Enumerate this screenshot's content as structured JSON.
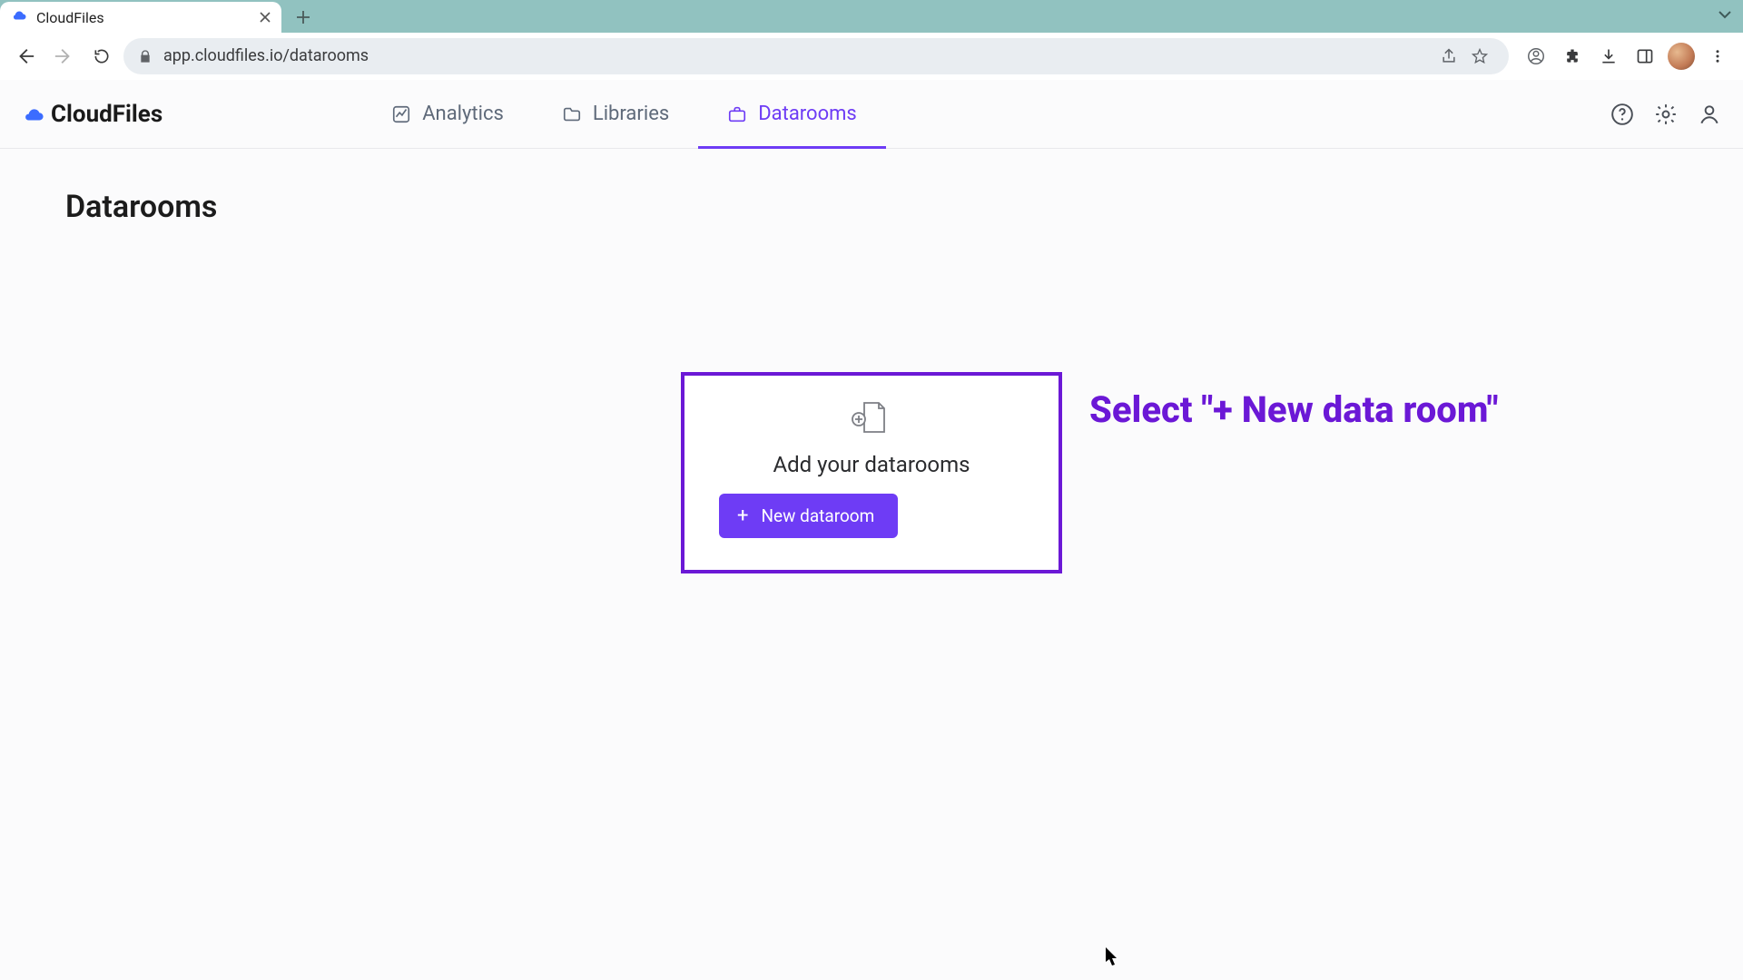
{
  "browser": {
    "tab_title": "CloudFiles",
    "url": "app.cloudfiles.io/datarooms"
  },
  "app": {
    "brand": "CloudFiles",
    "nav": {
      "analytics": "Analytics",
      "libraries": "Libraries",
      "datarooms": "Datarooms"
    }
  },
  "page": {
    "title": "Datarooms"
  },
  "empty_state": {
    "heading": "Add your datarooms",
    "button_label": "New dataroom"
  },
  "annotation": {
    "text": "Select \"+ New data room\""
  }
}
